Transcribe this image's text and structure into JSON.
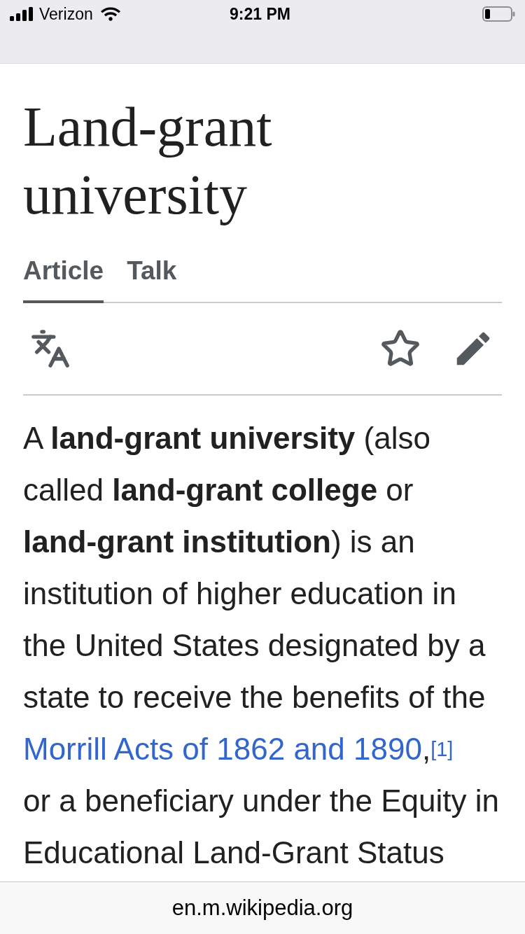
{
  "status_bar": {
    "carrier": "Verizon",
    "time": "9:21 PM"
  },
  "article": {
    "title": "Land-grant university"
  },
  "tabs": [
    {
      "label": "Article",
      "selected": true
    },
    {
      "label": "Talk",
      "selected": false
    }
  ],
  "paragraph": {
    "lines": [
      [
        {
          "kind": "text",
          "text": "A **land-grant university** (also"
        }
      ],
      [
        {
          "kind": "text",
          "text": "called **land-grant college** or"
        }
      ],
      [
        {
          "kind": "text",
          "text": "**land-grant institution**) is an"
        }
      ],
      [
        {
          "kind": "text",
          "text": "institution of higher education in"
        }
      ],
      [
        {
          "kind": "text",
          "text": "the United States designated by a"
        }
      ],
      [
        {
          "kind": "text",
          "text": "state to receive the benefits of the"
        }
      ],
      [
        {
          "kind": "link",
          "text": "Morrill Acts of 1862 and 1890"
        },
        {
          "kind": "text",
          "text": ","
        },
        {
          "kind": "ref",
          "text": "[1]"
        }
      ],
      [
        {
          "kind": "text",
          "text": "or a beneficiary under the Equity in"
        }
      ],
      [
        {
          "kind": "text",
          "text": "Educational Land-Grant Status"
        }
      ]
    ]
  },
  "address_bar": {
    "url": "en.m.wikipedia.org"
  }
}
